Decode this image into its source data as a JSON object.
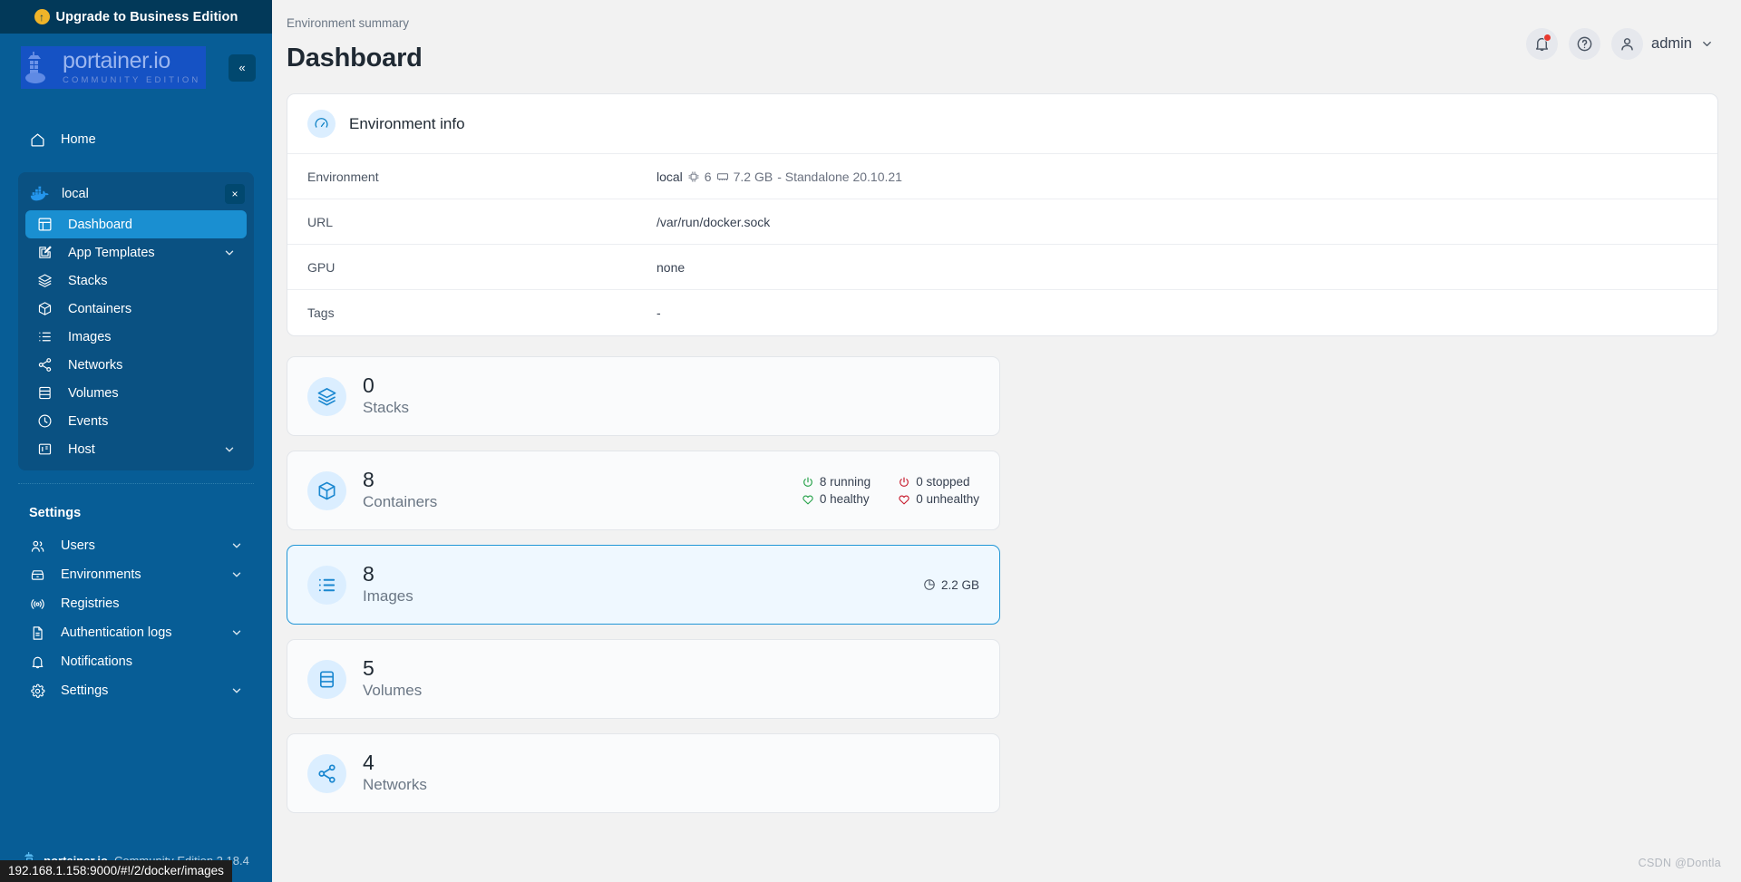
{
  "sidebar": {
    "upgrade_banner": {
      "label": "Upgrade to Business Edition",
      "icon": "upgrade-arrow-icon"
    },
    "logo": {
      "brand": "portainer.io",
      "edition": "COMMUNITY EDITION"
    },
    "collapse_icon": "«",
    "home": {
      "label": "Home",
      "icon": "home-icon"
    },
    "environment": {
      "name": "local",
      "icon": "docker-icon",
      "close_icon": "×",
      "items": [
        {
          "label": "Dashboard",
          "icon": "dashboard-icon",
          "active": true,
          "chevron": false
        },
        {
          "label": "App Templates",
          "icon": "edit-square-icon",
          "active": false,
          "chevron": true
        },
        {
          "label": "Stacks",
          "icon": "layers-icon",
          "active": false,
          "chevron": false
        },
        {
          "label": "Containers",
          "icon": "cube-icon",
          "active": false,
          "chevron": false
        },
        {
          "label": "Images",
          "icon": "list-icon",
          "active": false,
          "chevron": false
        },
        {
          "label": "Networks",
          "icon": "share-nodes-icon",
          "active": false,
          "chevron": false
        },
        {
          "label": "Volumes",
          "icon": "database-icon",
          "active": false,
          "chevron": false
        },
        {
          "label": "Events",
          "icon": "clock-icon",
          "active": false,
          "chevron": false
        },
        {
          "label": "Host",
          "icon": "server-icon",
          "active": false,
          "chevron": true
        }
      ]
    },
    "settings_label": "Settings",
    "settings_items": [
      {
        "label": "Users",
        "icon": "users-icon",
        "chevron": true
      },
      {
        "label": "Environments",
        "icon": "box-icon",
        "chevron": true
      },
      {
        "label": "Registries",
        "icon": "radio-icon",
        "chevron": false
      },
      {
        "label": "Authentication logs",
        "icon": "document-icon",
        "chevron": true
      },
      {
        "label": "Notifications",
        "icon": "bell-icon",
        "chevron": false
      },
      {
        "label": "Settings",
        "icon": "gear-icon",
        "chevron": true
      }
    ],
    "footer": {
      "brand": "portainer.io",
      "edition": "Community Edition 2.18.4"
    }
  },
  "status_bar": {
    "url": "192.168.1.158:9000/#!/2/docker/images"
  },
  "header": {
    "breadcrumb": "Environment summary",
    "title": "Dashboard",
    "notifications_icon": "bell-icon",
    "help_icon": "question-circle-icon",
    "avatar_icon": "user-icon",
    "user": "admin",
    "caret_icon": "chevron-down-icon"
  },
  "environment_info": {
    "title": "Environment info",
    "icon": "gauge-icon",
    "rows": [
      {
        "key": "Environment",
        "value": "local",
        "cpu_icon": "cpu-icon",
        "cpu": "6",
        "memory_icon": "memory-icon",
        "memory": "7.2 GB",
        "suffix": "- Standalone 20.10.21"
      },
      {
        "key": "URL",
        "value": "/var/run/docker.sock"
      },
      {
        "key": "GPU",
        "value": "none"
      },
      {
        "key": "Tags",
        "value": "-"
      }
    ]
  },
  "stats": [
    {
      "count": "0",
      "label": "Stacks",
      "icon": "layers-icon",
      "highlight": false,
      "extra": null,
      "single": null
    },
    {
      "count": "8",
      "label": "Containers",
      "icon": "cube-icon",
      "highlight": false,
      "extra": [
        {
          "icon": "power-icon",
          "tone": "green",
          "text": "8 running"
        },
        {
          "icon": "power-icon",
          "tone": "red",
          "text": "0 stopped"
        },
        {
          "icon": "heart-icon",
          "tone": "green",
          "text": "0 healthy"
        },
        {
          "icon": "heart-icon",
          "tone": "red",
          "text": "0 unhealthy"
        }
      ],
      "single": null
    },
    {
      "count": "8",
      "label": "Images",
      "icon": "list-icon",
      "highlight": true,
      "extra": null,
      "single": {
        "icon": "pie-clock-icon",
        "text": "2.2 GB"
      }
    },
    {
      "count": "5",
      "label": "Volumes",
      "icon": "database-icon",
      "highlight": false,
      "extra": null,
      "single": null
    },
    {
      "count": "4",
      "label": "Networks",
      "icon": "share-nodes-icon",
      "highlight": false,
      "extra": null,
      "single": null
    }
  ],
  "watermark": "CSDN @Dontla",
  "colors": {
    "sidebar_bg": "#075d96",
    "banner_bg": "#023959",
    "active_item": "#1a8fd1",
    "accent": "#2196d6",
    "green": "#24a148",
    "red": "#c6192b",
    "badge": "#e8392f"
  }
}
